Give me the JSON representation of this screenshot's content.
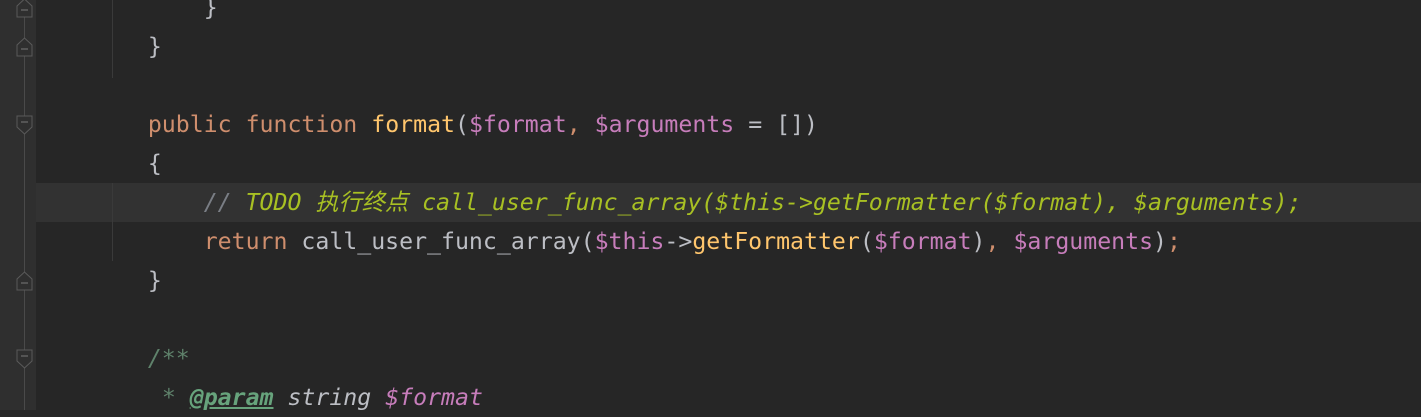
{
  "editor": {
    "highlighted_line": 5,
    "lines": [
      [
        {
          "t": "        "
        },
        {
          "t": "}",
          "c": "punc"
        }
      ],
      [
        {
          "t": "    "
        },
        {
          "t": "}",
          "c": "punc"
        }
      ],
      [],
      [
        {
          "t": "    "
        },
        {
          "t": "public",
          "c": "kw"
        },
        {
          "t": " "
        },
        {
          "t": "function",
          "c": "kw"
        },
        {
          "t": " "
        },
        {
          "t": "format",
          "c": "fn"
        },
        {
          "t": "(",
          "c": "punc"
        },
        {
          "t": "$format",
          "c": "var"
        },
        {
          "t": ", ",
          "c": "op"
        },
        {
          "t": "$arguments",
          "c": "var"
        },
        {
          "t": " = [])",
          "c": "punc"
        }
      ],
      [
        {
          "t": "    "
        },
        {
          "t": "{",
          "c": "punc"
        }
      ],
      [
        {
          "t": "        "
        },
        {
          "t": "// ",
          "c": "cm"
        },
        {
          "t": "TODO 执行终点 call_user_func_array($this->getFormatter($format), $arguments);",
          "c": "todo"
        }
      ],
      [
        {
          "t": "        "
        },
        {
          "t": "return",
          "c": "kw"
        },
        {
          "t": " call_user_func_array(",
          "c": "punc"
        },
        {
          "t": "$this",
          "c": "var"
        },
        {
          "t": "->",
          "c": "punc"
        },
        {
          "t": "getFormatter",
          "c": "fn"
        },
        {
          "t": "(",
          "c": "punc"
        },
        {
          "t": "$format",
          "c": "var"
        },
        {
          "t": ")",
          "c": "punc"
        },
        {
          "t": ", ",
          "c": "op"
        },
        {
          "t": "$arguments",
          "c": "var"
        },
        {
          "t": ")",
          "c": "punc"
        },
        {
          "t": ";",
          "c": "op"
        }
      ],
      [
        {
          "t": "    "
        },
        {
          "t": "}",
          "c": "punc"
        }
      ],
      [],
      [
        {
          "t": "    "
        },
        {
          "t": "/**",
          "c": "doc"
        }
      ],
      [
        {
          "t": "     "
        },
        {
          "t": "* ",
          "c": "doc"
        },
        {
          "t": "@param",
          "c": "doctag"
        },
        {
          "t": " string ",
          "c": "doctype"
        },
        {
          "t": "$format",
          "c": "docvar"
        }
      ]
    ]
  }
}
